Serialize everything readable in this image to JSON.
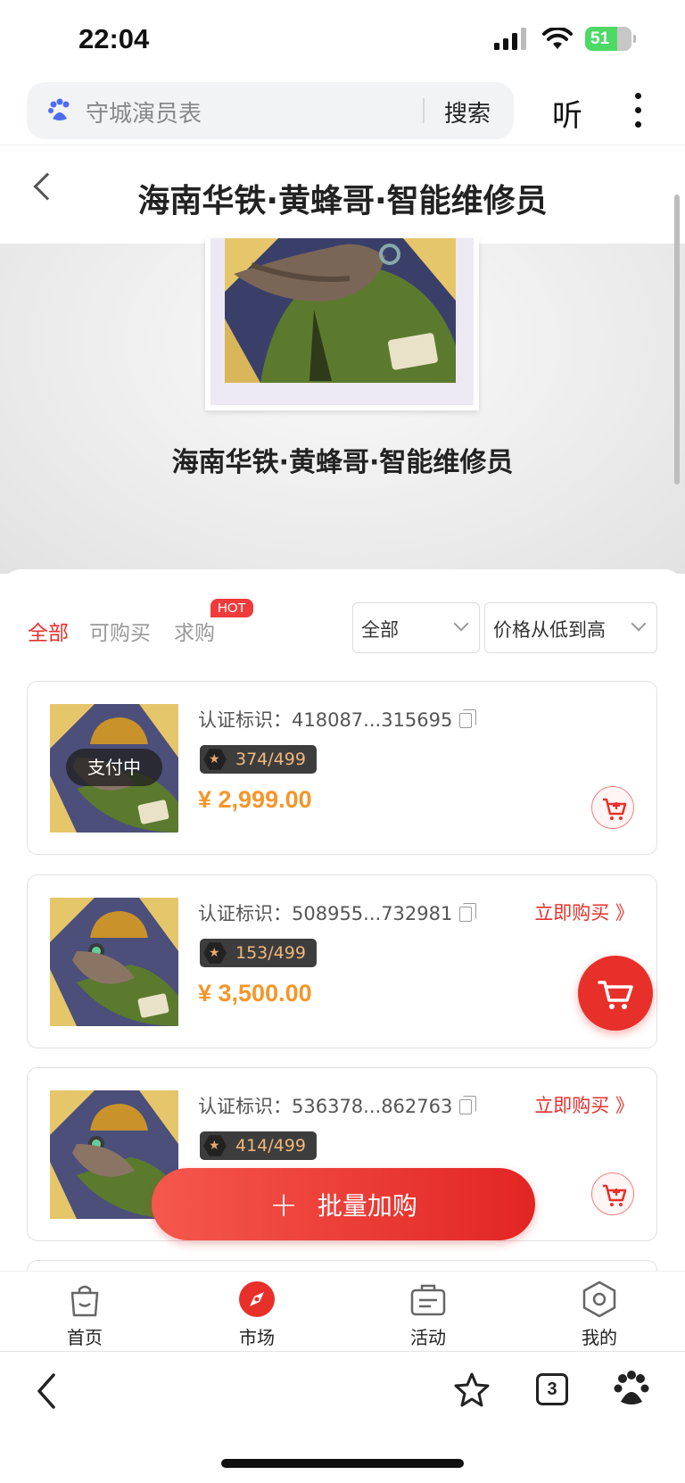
{
  "status_bar": {
    "time": "22:04",
    "battery": "51"
  },
  "search": {
    "placeholder": "守城演员表",
    "button": "搜索",
    "listen": "听"
  },
  "header": {
    "title": "海南华铁·黄蜂哥·智能维修员"
  },
  "hero": {
    "name": "海南华铁·黄蜂哥·智能维修员"
  },
  "filters": {
    "tabs": [
      {
        "label": "全部",
        "active": true
      },
      {
        "label": "可购买"
      },
      {
        "label": "求购"
      }
    ],
    "hot_badge": "HOT",
    "category_select": "全部",
    "sort_select": "价格从低到高"
  },
  "listings": [
    {
      "cert_label": "认证标识：",
      "cert_id": "418087...315695",
      "edition": "374/499",
      "price": "¥ 2,999.00",
      "status": "支付中",
      "buy_now": ""
    },
    {
      "cert_label": "认证标识：",
      "cert_id": "508955...732981",
      "edition": "153/499",
      "price": "¥ 3,500.00",
      "status": "",
      "buy_now": "立即购买 》"
    },
    {
      "cert_label": "认证标识：",
      "cert_id": "536378...862763",
      "edition": "414/499",
      "price": "",
      "status": "",
      "buy_now": "立即购买 》"
    }
  ],
  "bulk_button": {
    "label": "批量加购"
  },
  "bottom_nav": [
    {
      "label": "首页",
      "icon": "bag-icon"
    },
    {
      "label": "市场",
      "icon": "compass-icon",
      "active": true
    },
    {
      "label": "活动",
      "icon": "briefcase-icon"
    },
    {
      "label": "我的",
      "icon": "hexagon-icon"
    }
  ],
  "browser_bar": {
    "tabs_count": "3"
  },
  "colors": {
    "accent": "#e8302b",
    "price": "#f4962a",
    "edition_text": "#f0b77b"
  }
}
